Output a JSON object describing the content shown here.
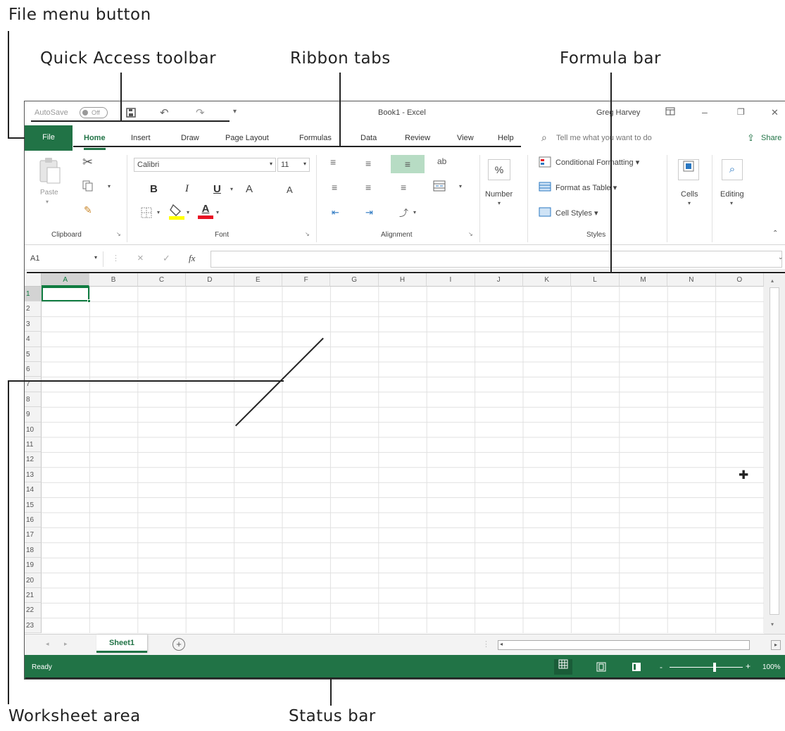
{
  "callouts": {
    "file_menu": "File menu button",
    "quick_access": "Quick Access toolbar",
    "ribbon_tabs": "Ribbon tabs",
    "formula_bar": "Formula bar",
    "worksheet_area": "Worksheet area",
    "status_bar": "Status bar"
  },
  "titlebar": {
    "autosave": "AutoSave",
    "autosave_state": "Off",
    "title": "Book1 - Excel",
    "user": "Greg Harvey",
    "minimize": "–",
    "restore": "❐",
    "close": "✕"
  },
  "tabs": {
    "file": "File",
    "home": "Home",
    "insert": "Insert",
    "draw": "Draw",
    "page_layout": "Page Layout",
    "formulas": "Formulas",
    "data": "Data",
    "review": "Review",
    "view": "View",
    "help": "Help",
    "tell_me": "Tell me what you want to do",
    "share": "Share"
  },
  "ribbon": {
    "paste": "Paste",
    "clipboard": "Clipboard",
    "font_name": "Calibri",
    "font_size": "11",
    "bold": "B",
    "italic": "I",
    "underline": "U",
    "grow_font": "A",
    "shrink_font": "A",
    "font_color_letter": "A",
    "font": "Font",
    "alignment": "Alignment",
    "wrap_text": "ab",
    "number": "Number",
    "percent": "%",
    "conditional_formatting": "Conditional Formatting",
    "format_as_table": "Format as Table",
    "cell_styles": "Cell Styles",
    "styles": "Styles",
    "cells": "Cells",
    "editing": "Editing",
    "fill_color": "#ffff00",
    "font_color": "#e81123"
  },
  "formula_bar": {
    "name_box": "A1",
    "cancel": "×",
    "enter": "✓",
    "fx": "fx"
  },
  "grid": {
    "columns": [
      "A",
      "B",
      "C",
      "D",
      "E",
      "F",
      "G",
      "H",
      "I",
      "J",
      "K",
      "L",
      "M",
      "N",
      "O"
    ],
    "rows": [
      "1",
      "2",
      "3",
      "4",
      "5",
      "6",
      "7",
      "8",
      "9",
      "10",
      "11",
      "12",
      "13",
      "14",
      "15",
      "16",
      "17",
      "18",
      "19",
      "20",
      "21",
      "22",
      "23"
    ]
  },
  "sheet_tabs": {
    "sheet1": "Sheet1",
    "add": "+"
  },
  "status": {
    "ready": "Ready",
    "zoom": "100%",
    "zoom_minus": "-",
    "zoom_plus": "+"
  },
  "colors": {
    "excel_green": "#217346",
    "selection_green": "#107c41"
  }
}
